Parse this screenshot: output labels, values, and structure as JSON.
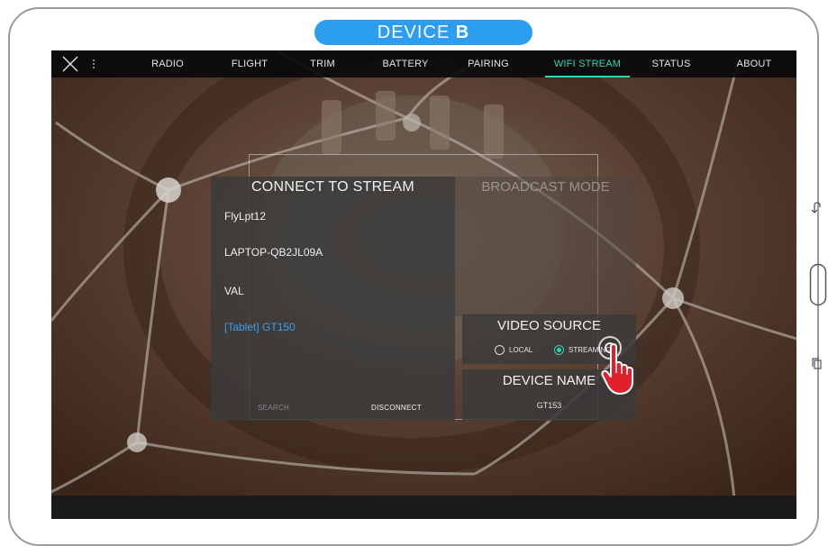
{
  "header": {
    "device_label_prefix": "DEVICE",
    "device_label_letter": "B"
  },
  "nav": {
    "close_icon": "close-x-icon",
    "menu_icon": "vertical-dots-icon",
    "tabs": [
      {
        "label": "RADIO",
        "active": false
      },
      {
        "label": "FLIGHT",
        "active": false
      },
      {
        "label": "TRIM",
        "active": false
      },
      {
        "label": "BATTERY",
        "active": false
      },
      {
        "label": "PAIRING",
        "active": false
      },
      {
        "label": "WIFI STREAM",
        "active": true
      },
      {
        "label": "STATUS",
        "active": false
      },
      {
        "label": "ABOUT",
        "active": false
      }
    ],
    "active_color": "#2fd5b2"
  },
  "connect_panel": {
    "title": "CONNECT TO STREAM",
    "networks": [
      {
        "name": "FlyLpt12",
        "selected": false
      },
      {
        "name": "LAPTOP-QB2JL09A",
        "selected": false
      },
      {
        "name": "VAL",
        "selected": false
      },
      {
        "name": "[Tablet] GT150",
        "selected": true
      }
    ],
    "search_label": "SEARCH",
    "disconnect_label": "DISCONNECT",
    "selected_color": "#3aa0f2"
  },
  "broadcast": {
    "title": "BROADCAST MODE"
  },
  "video_source": {
    "title": "VIDEO SOURCE",
    "options": [
      {
        "label": "LOCAL",
        "selected": false
      },
      {
        "label": "STREAMING",
        "selected": true
      }
    ]
  },
  "device_name": {
    "title": "DEVICE NAME",
    "value": "GT153"
  },
  "tablet_buttons": [
    "back-icon",
    "home-icon",
    "recent-apps-icon"
  ],
  "colors": {
    "device_pill": "#2b9ef2",
    "accent": "#2fd5b2",
    "tap_hand": "#e0202a"
  }
}
